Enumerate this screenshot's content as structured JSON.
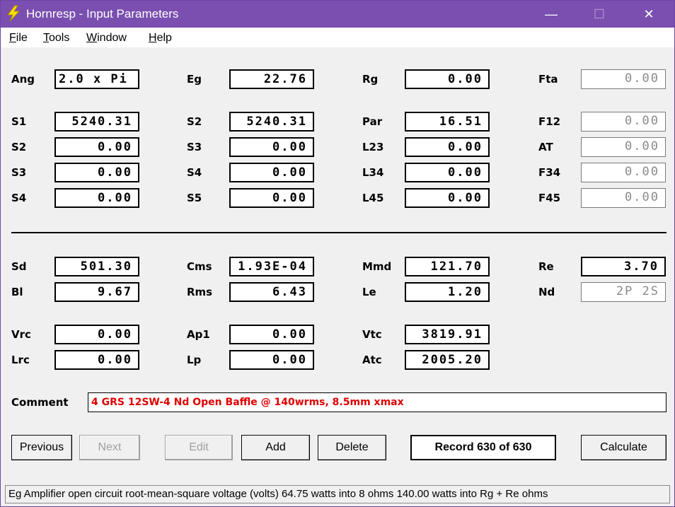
{
  "window": {
    "title": "Hornresp - Input Parameters",
    "app_icon": "lightning-bolt-icon",
    "minimize": "—",
    "maximize": "☐",
    "close": "✕"
  },
  "menu": [
    {
      "first": "F",
      "rest": "ile"
    },
    {
      "first": "T",
      "rest": "ools"
    },
    {
      "first": "W",
      "rest": "indow"
    },
    {
      "first": "H",
      "rest": "elp"
    }
  ],
  "params": {
    "ang": {
      "label": "Ang",
      "value": "2.0 x Pi"
    },
    "eg": {
      "label": "Eg",
      "value": "22.76"
    },
    "rg": {
      "label": "Rg",
      "value": "0.00"
    },
    "fta": {
      "label": "Fta",
      "value": "0.00"
    },
    "s1": {
      "label": "S1",
      "value": "5240.31"
    },
    "s2b": {
      "label": "S2",
      "value": "5240.31"
    },
    "par": {
      "label": "Par",
      "value": "16.51"
    },
    "f12": {
      "label": "F12",
      "value": "0.00"
    },
    "s2": {
      "label": "S2",
      "value": "0.00"
    },
    "s3b": {
      "label": "S3",
      "value": "0.00"
    },
    "l23": {
      "label": "L23",
      "value": "0.00"
    },
    "at": {
      "label": "AT",
      "value": "0.00"
    },
    "s3": {
      "label": "S3",
      "value": "0.00"
    },
    "s4b": {
      "label": "S4",
      "value": "0.00"
    },
    "l34": {
      "label": "L34",
      "value": "0.00"
    },
    "f34": {
      "label": "F34",
      "value": "0.00"
    },
    "s4": {
      "label": "S4",
      "value": "0.00"
    },
    "s5": {
      "label": "S5",
      "value": "0.00"
    },
    "l45": {
      "label": "L45",
      "value": "0.00"
    },
    "f45": {
      "label": "F45",
      "value": "0.00"
    },
    "sd": {
      "label": "Sd",
      "value": "501.30"
    },
    "cms": {
      "label": "Cms",
      "value": "1.93E-04"
    },
    "mmd": {
      "label": "Mmd",
      "value": "121.70"
    },
    "re": {
      "label": "Re",
      "value": "3.70"
    },
    "bl": {
      "label": "Bl",
      "value": "9.67"
    },
    "rms": {
      "label": "Rms",
      "value": "6.43"
    },
    "le": {
      "label": "Le",
      "value": "1.20"
    },
    "nd": {
      "label": "Nd",
      "value": "2P 2S"
    },
    "vrc": {
      "label": "Vrc",
      "value": "0.00"
    },
    "ap1": {
      "label": "Ap1",
      "value": "0.00"
    },
    "vtc": {
      "label": "Vtc",
      "value": "3819.91"
    },
    "lrc": {
      "label": "Lrc",
      "value": "0.00"
    },
    "lp": {
      "label": "Lp",
      "value": "0.00"
    },
    "atc": {
      "label": "Atc",
      "value": "2005.20"
    }
  },
  "comment": {
    "label": "Comment",
    "value": "4 GRS 12SW-4 Nd Open Baffle @ 140wrms, 8.5mm xmax",
    "color": "#e00000"
  },
  "buttons": {
    "previous": "Previous",
    "next": "Next",
    "edit": "Edit",
    "add": "Add",
    "delete": "Delete",
    "record": "Record 630 of 630",
    "calculate": "Calculate"
  },
  "status": "Eg  Amplifier open circuit root-mean-square voltage  (volts)  64.75 watts into 8 ohms   140.00 watts into Rg + Re ohms"
}
